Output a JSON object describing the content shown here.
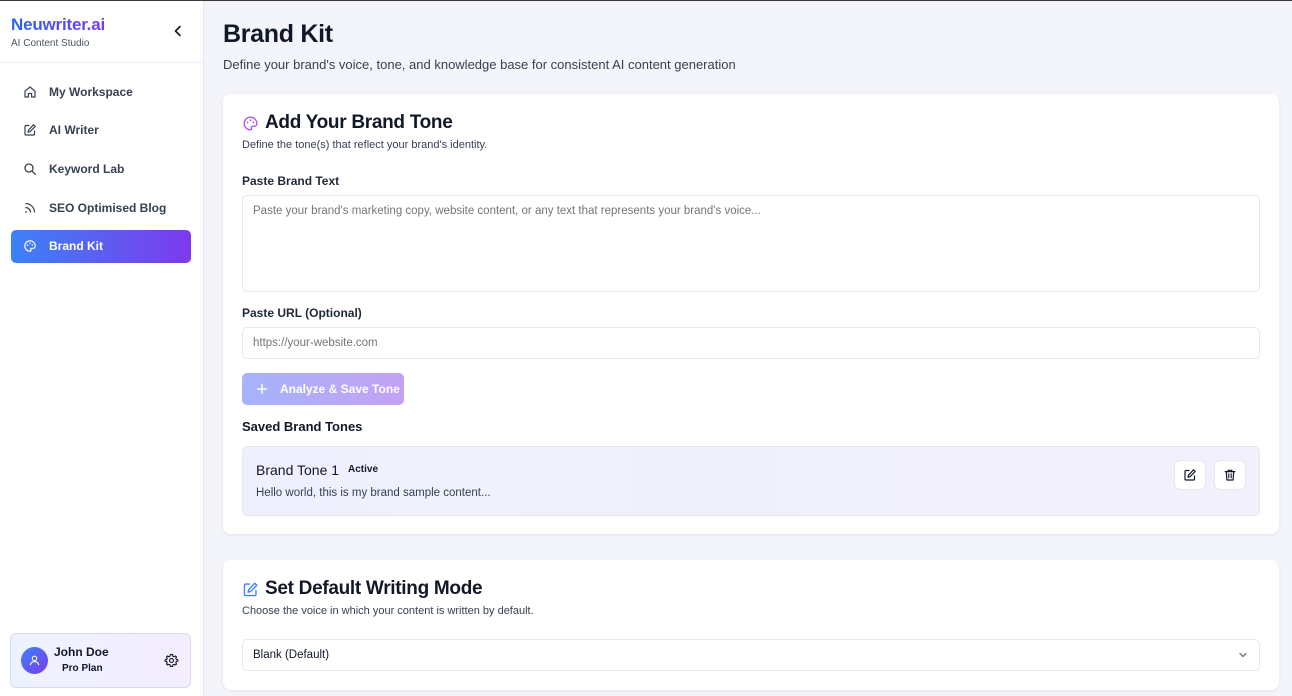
{
  "app": {
    "name": "Neuwriter.ai",
    "subtitle": "AI Content Studio"
  },
  "sidebar": {
    "items": [
      {
        "label": "My Workspace",
        "icon": "home-icon",
        "active": false
      },
      {
        "label": "AI Writer",
        "icon": "edit-icon",
        "active": false
      },
      {
        "label": "Keyword Lab",
        "icon": "search-icon",
        "active": false
      },
      {
        "label": "SEO Optimised Blog",
        "icon": "rss-icon",
        "active": false
      },
      {
        "label": "Brand Kit",
        "icon": "palette-icon",
        "active": true
      }
    ]
  },
  "user": {
    "name": "John Doe",
    "plan": "Pro Plan"
  },
  "page": {
    "title": "Brand Kit",
    "subtitle": "Define your brand's voice, tone, and knowledge base for consistent AI content generation"
  },
  "brand_tone": {
    "title": "Add Your Brand Tone",
    "description": "Define the tone(s) that reflect your brand's identity.",
    "text_label": "Paste Brand Text",
    "text_placeholder": "Paste your brand's marketing copy, website content, or any text that represents your brand's voice...",
    "url_label": "Paste URL (Optional)",
    "url_placeholder": "https://your-website.com",
    "analyze_button": "Analyze & Save Tone",
    "saved_label": "Saved Brand Tones",
    "saved": [
      {
        "name": "Brand Tone 1",
        "badge": "Active",
        "text": "Hello world, this is my brand sample content..."
      }
    ]
  },
  "writing_mode": {
    "title": "Set Default Writing Mode",
    "description": "Choose the voice in which your content is written by default.",
    "selected": "Blank (Default)"
  },
  "colors": {
    "accent_blue": "#3b82f6",
    "accent_purple": "#7c3aed"
  }
}
